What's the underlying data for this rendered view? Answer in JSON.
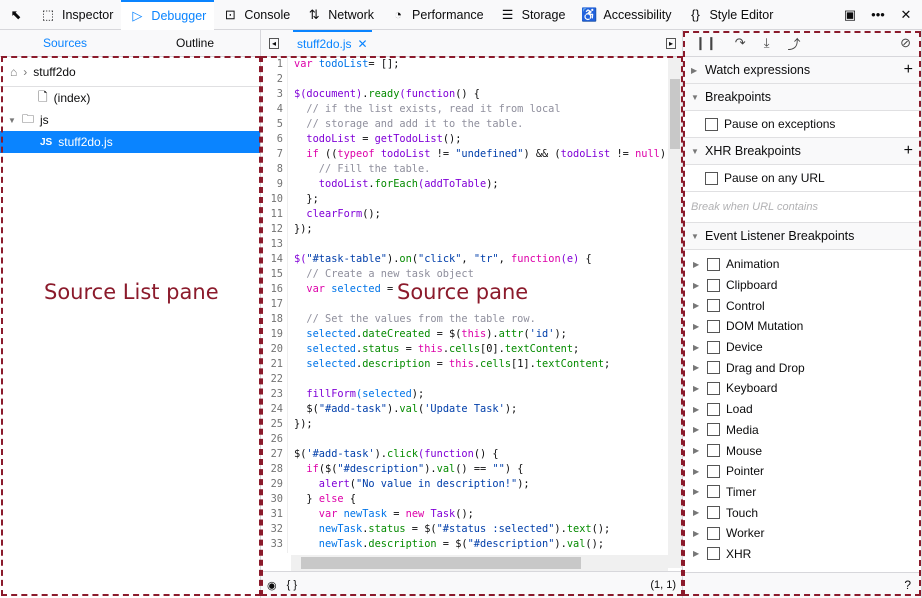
{
  "toolbar": {
    "tabs": [
      {
        "label": "Inspector",
        "icon": "inspector-icon",
        "glyph": "⬚"
      },
      {
        "label": "Debugger",
        "icon": "debugger-icon",
        "glyph": "▷"
      },
      {
        "label": "Console",
        "icon": "console-icon",
        "glyph": "⊡"
      },
      {
        "label": "Network",
        "icon": "network-icon",
        "glyph": "⇅"
      },
      {
        "label": "Performance",
        "icon": "performance-icon",
        "glyph": "◔"
      },
      {
        "label": "Storage",
        "icon": "storage-icon",
        "glyph": "☰"
      },
      {
        "label": "Accessibility",
        "icon": "accessibility-icon",
        "glyph": "♿"
      },
      {
        "label": "Style Editor",
        "icon": "style-editor-icon",
        "glyph": "{}"
      }
    ],
    "active": "Debugger"
  },
  "left": {
    "tabs": [
      "Sources",
      "Outline"
    ],
    "root": "stuff2do",
    "index": "(index)",
    "folder": "js",
    "file_badge": "JS",
    "file": "stuff2do.js",
    "overlay": "Source List pane"
  },
  "mid": {
    "tab": "stuff2do.js",
    "overlay": "Source pane",
    "footer_braces": "{ }",
    "position": "(1, 1)",
    "lines": [
      [
        [
          "k",
          "var "
        ],
        [
          "v",
          "todoList"
        ],
        [
          "",
          "= [];"
        ]
      ],
      [],
      [
        [
          "f",
          "$(document)"
        ],
        [
          "",
          "."
        ],
        [
          "m",
          "ready"
        ],
        [
          "f",
          "(function"
        ],
        [
          "",
          "() {"
        ]
      ],
      [
        [
          "c",
          "  // if the list exists, read it from local"
        ]
      ],
      [
        [
          "c",
          "  // storage and add it to the table."
        ]
      ],
      [
        [
          "f",
          "  todoList"
        ],
        [
          "",
          " = "
        ],
        [
          "f",
          "getTodoList"
        ],
        [
          "",
          "();"
        ]
      ],
      [
        [
          "k",
          "  if "
        ],
        [
          "",
          "(("
        ],
        [
          "k",
          "typeof "
        ],
        [
          "f",
          "todoList"
        ],
        [
          "",
          " != "
        ],
        [
          "s",
          "\"undefined\""
        ],
        [
          "",
          ") && ("
        ],
        [
          "f",
          "todoList"
        ],
        [
          "",
          " != "
        ],
        [
          "k",
          "null"
        ],
        [
          "",
          "))"
        ]
      ],
      [
        [
          "c",
          "    // Fill the table."
        ]
      ],
      [
        [
          "f",
          "    todoList"
        ],
        [
          "",
          "."
        ],
        [
          "m",
          "forEach"
        ],
        [
          "f",
          "(addToTable"
        ],
        [
          "",
          ");"
        ]
      ],
      [
        [
          "",
          "  };"
        ]
      ],
      [
        [
          "f",
          "  clearForm"
        ],
        [
          "",
          "();"
        ]
      ],
      [
        [
          "",
          "});"
        ]
      ],
      [],
      [
        [
          "f",
          "$("
        ],
        [
          "s",
          "\"#task-table\""
        ],
        [
          "",
          ")."
        ],
        [
          "m",
          "on"
        ],
        [
          "",
          "("
        ],
        [
          "s",
          "\"click\""
        ],
        [
          "",
          ", "
        ],
        [
          "s",
          "\"tr\""
        ],
        [
          "",
          ", "
        ],
        [
          "k",
          "function"
        ],
        [
          "f",
          "(e)"
        ],
        [
          "",
          " {"
        ]
      ],
      [
        [
          "c",
          "  // Create a new task object"
        ]
      ],
      [
        [
          "k",
          "  var "
        ],
        [
          "v",
          "selected"
        ],
        [
          "",
          " = "
        ]
      ],
      [],
      [
        [
          "c",
          "  // Set the values from the table row."
        ]
      ],
      [
        [
          "v",
          "  selected"
        ],
        [
          "",
          "."
        ],
        [
          "m",
          "dateCreated"
        ],
        [
          "",
          " = $("
        ],
        [
          "k",
          "this"
        ],
        [
          "",
          ")."
        ],
        [
          "m",
          "attr"
        ],
        [
          "",
          "("
        ],
        [
          "s",
          "'id'"
        ],
        [
          "",
          ");"
        ]
      ],
      [
        [
          "v",
          "  selected"
        ],
        [
          "",
          "."
        ],
        [
          "m",
          "status"
        ],
        [
          "",
          " = "
        ],
        [
          "k",
          "this"
        ],
        [
          "",
          "."
        ],
        [
          "m",
          "cells"
        ],
        [
          "",
          "[0]."
        ],
        [
          "m",
          "textContent"
        ],
        [
          "",
          ";"
        ]
      ],
      [
        [
          "v",
          "  selected"
        ],
        [
          "",
          "."
        ],
        [
          "m",
          "description"
        ],
        [
          "",
          " = "
        ],
        [
          "k",
          "this"
        ],
        [
          "",
          "."
        ],
        [
          "m",
          "cells"
        ],
        [
          "",
          "[1]."
        ],
        [
          "m",
          "textContent"
        ],
        [
          "",
          ";"
        ]
      ],
      [],
      [
        [
          "f",
          "  fillForm"
        ],
        [
          "v",
          "(selected"
        ],
        [
          "",
          ");"
        ]
      ],
      [
        [
          "",
          "  $("
        ],
        [
          "s",
          "\"#add-task\""
        ],
        [
          "",
          ")."
        ],
        [
          "m",
          "val"
        ],
        [
          "",
          "("
        ],
        [
          "s",
          "'Update Task'"
        ],
        [
          "",
          ");"
        ]
      ],
      [
        [
          "",
          "});"
        ]
      ],
      [],
      [
        [
          "",
          "$("
        ],
        [
          "s",
          "'#add-task'"
        ],
        [
          "",
          ")."
        ],
        [
          "m",
          "click"
        ],
        [
          "f",
          "(function"
        ],
        [
          "",
          "() {"
        ]
      ],
      [
        [
          "k",
          "  if"
        ],
        [
          "",
          "($("
        ],
        [
          "s",
          "\"#description\""
        ],
        [
          "",
          ")."
        ],
        [
          "m",
          "val"
        ],
        [
          "",
          "() == "
        ],
        [
          "s",
          "\"\""
        ],
        [
          "",
          ") {"
        ]
      ],
      [
        [
          "f",
          "    alert"
        ],
        [
          "",
          "("
        ],
        [
          "s",
          "\"No value in description!\""
        ],
        [
          "",
          ");"
        ]
      ],
      [
        [
          "",
          "  } "
        ],
        [
          "k",
          "else"
        ],
        [
          "",
          " {"
        ]
      ],
      [
        [
          "k",
          "    var "
        ],
        [
          "v",
          "newTask"
        ],
        [
          "",
          " = "
        ],
        [
          "k",
          "new "
        ],
        [
          "f",
          "Task"
        ],
        [
          "",
          "();"
        ]
      ],
      [
        [
          "v",
          "    newTask"
        ],
        [
          "",
          "."
        ],
        [
          "m",
          "status"
        ],
        [
          "",
          " = $("
        ],
        [
          "s",
          "\"#status :selected\""
        ],
        [
          "",
          ")."
        ],
        [
          "m",
          "text"
        ],
        [
          "",
          "();"
        ]
      ],
      [
        [
          "v",
          "    newTask"
        ],
        [
          "",
          "."
        ],
        [
          "m",
          "description"
        ],
        [
          "",
          " = $("
        ],
        [
          "s",
          "\"#description\""
        ],
        [
          "",
          ")."
        ],
        [
          "m",
          "val"
        ],
        [
          "",
          "();"
        ]
      ],
      []
    ]
  },
  "right": {
    "watch": "Watch expressions",
    "breakpoints": "Breakpoints",
    "pause_exceptions": "Pause on exceptions",
    "xhr": "XHR Breakpoints",
    "pause_url": "Pause on any URL",
    "url_placeholder": "Break when URL contains",
    "event": "Event Listener Breakpoints",
    "events": [
      "Animation",
      "Clipboard",
      "Control",
      "DOM Mutation",
      "Device",
      "Drag and Drop",
      "Keyboard",
      "Load",
      "Media",
      "Mouse",
      "Pointer",
      "Timer",
      "Touch",
      "Worker",
      "XHR"
    ]
  }
}
